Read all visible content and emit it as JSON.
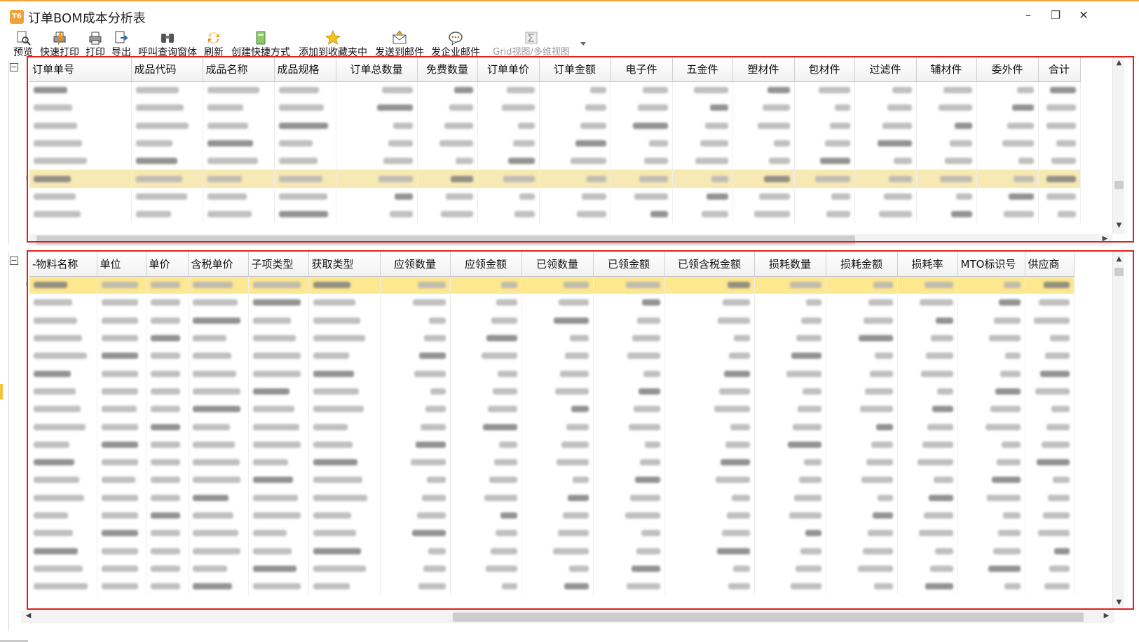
{
  "window": {
    "title": "订单BOM成本分析表",
    "app_badge": "T6",
    "controls": {
      "minimize": "–",
      "restore": "❐",
      "close": "✕"
    }
  },
  "toolbar": {
    "buttons": [
      {
        "label": "预览",
        "icon": "preview-icon"
      },
      {
        "label": "快速打印",
        "icon": "quick-print-icon"
      },
      {
        "label": "打印",
        "icon": "print-icon"
      },
      {
        "label": "导出",
        "icon": "export-icon"
      },
      {
        "label": "呼叫查询窗体",
        "icon": "binoculars-icon"
      },
      {
        "label": "刷新",
        "icon": "refresh-icon"
      },
      {
        "label": "创建快捷方式",
        "icon": "shortcut-icon"
      },
      {
        "label": "添加到收藏夹中",
        "icon": "star-icon"
      },
      {
        "label": "发送到邮件",
        "icon": "mail-icon"
      },
      {
        "label": "发企业邮件",
        "icon": "chat-icon"
      },
      {
        "label": "Grid视图/多维视图",
        "icon": "sigma-icon",
        "disabled": true
      }
    ]
  },
  "upper_grid": {
    "columns": [
      "订单单号",
      "成品代码",
      "成品名称",
      "成品规格",
      "订单总数量",
      "免费数量",
      "订单单价",
      "订单金额",
      "电子件",
      "五金件",
      "塑材件",
      "包材件",
      "过滤件",
      "辅材件",
      "委外件",
      "合计"
    ],
    "row_count": 8,
    "selected_row_index": 5
  },
  "lower_grid": {
    "columns": [
      "-物料名称",
      "单位",
      "单价",
      "含税单价",
      "子项类型",
      "获取类型",
      "应领数量",
      "应领金额",
      "已领数量",
      "已领金额",
      "已领含税金额",
      "损耗数量",
      "损耗金额",
      "损耗率",
      "MTO标识号",
      "供应商"
    ],
    "row_count": 18,
    "selected_row_index": 0
  },
  "colors": {
    "accent_orange": "#f0a43a",
    "selected_row_upper": "#f7e9b3",
    "selected_row_lower": "#fde78f",
    "highlight_frame": "#e0201a"
  }
}
